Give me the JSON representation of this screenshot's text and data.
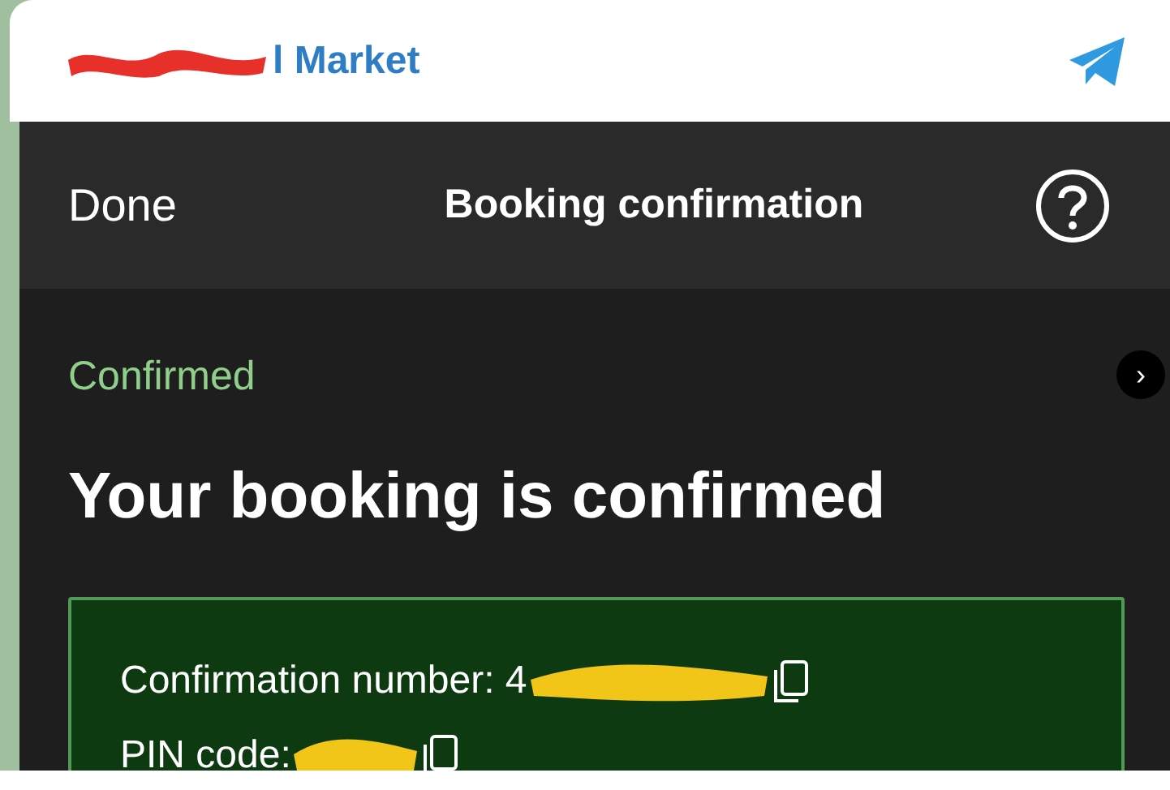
{
  "chat_header": {
    "title": "l Market"
  },
  "nav": {
    "left": "Done",
    "title": "Booking confirmation"
  },
  "status": "Confirmed",
  "headline": "Your booking is confirmed",
  "details": [
    {
      "label": "Confirmation number: 4"
    },
    {
      "label": "PIN code:"
    }
  ],
  "side_button": "›"
}
